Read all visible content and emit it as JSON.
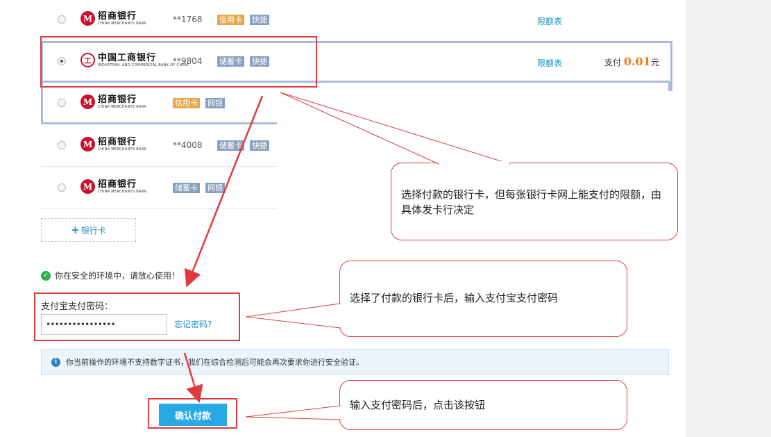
{
  "banks": [
    {
      "logo_cn": "招商银行",
      "logo_en": "CHINA MERCHANTS BANK",
      "logo_mark": "M",
      "card": "**1768",
      "tags": [
        "信用卡",
        "快捷"
      ],
      "tag_types": [
        "credit",
        "blue"
      ],
      "limit": "限额表",
      "selected": false
    },
    {
      "logo_cn": "中国工商银行",
      "logo_en": "INDUSTRIAL AND COMMERCIAL BANK OF CHINA",
      "logo_mark": "工",
      "card": "**9804",
      "tags": [
        "储蓄卡",
        "快捷"
      ],
      "tag_types": [
        "blue",
        "blue"
      ],
      "limit": "限额表",
      "selected": true
    },
    {
      "logo_cn": "招商银行",
      "logo_en": "CHINA MERCHANTS BANK",
      "logo_mark": "M",
      "card": "",
      "tags": [
        "信用卡",
        "网银"
      ],
      "tag_types": [
        "credit",
        "blue"
      ],
      "limit": "",
      "selected": false
    },
    {
      "logo_cn": "招商银行",
      "logo_en": "CHINA MERCHANTS BANK",
      "logo_mark": "M",
      "card": "**4008",
      "tags": [
        "储蓄卡",
        "快捷"
      ],
      "tag_types": [
        "blue",
        "blue"
      ],
      "limit": "",
      "selected": false
    },
    {
      "logo_cn": "招商银行",
      "logo_en": "CHINA MERCHANTS BANK",
      "logo_mark": "M",
      "card": "",
      "tags": [
        "储蓄卡",
        "网银"
      ],
      "tag_types": [
        "blue",
        "blue"
      ],
      "limit": "",
      "selected": false
    }
  ],
  "pay": {
    "prefix": "支付",
    "amount": "0.01",
    "unit": "元"
  },
  "add_card": {
    "plus": "+",
    "label": "银行卡"
  },
  "safe_msg": "你在安全的环境中，请放心使用！",
  "password": {
    "label": "支付宝支付密码：",
    "value": "••••••••••••••••",
    "forgot": "忘记密码?"
  },
  "notice": {
    "icon": "i",
    "text": "你当前操作的环境不支持数字证书，我们在综合检测后可能会再次要求你进行安全验证。"
  },
  "confirm_label": "确认付款",
  "callouts": [
    "选择付款的银行卡，但每张银行卡网上能支付的限额，由具体发卡行决定",
    "选择了付款的银行卡后，输入支付宝支付密码",
    "输入支付密码后，点击该按钮"
  ],
  "colors": {
    "annotation_red": "#e03b3b",
    "link_blue": "#1a8ec6",
    "button_blue": "#27a9e3",
    "amount_orange": "#f07a13"
  }
}
